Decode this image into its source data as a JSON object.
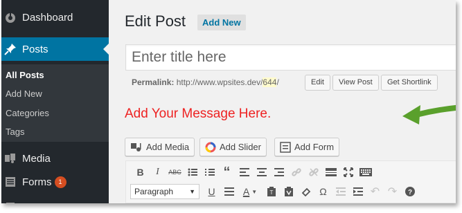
{
  "sidebar": {
    "dashboard": "Dashboard",
    "posts": "Posts",
    "submenu": [
      "All Posts",
      "Add New",
      "Categories",
      "Tags"
    ],
    "media": "Media",
    "forms": "Forms",
    "forms_badge": "1"
  },
  "main": {
    "title": "Edit Post",
    "add_new": "Add New",
    "title_placeholder": "Enter title here",
    "permalink_label": "Permalink:",
    "permalink_url": "http://www.wpsites.dev/",
    "permalink_slug": "644",
    "permalink_trail": "/",
    "edit_btn": "Edit",
    "view_post_btn": "View Post",
    "shortlink_btn": "Get Shortlink",
    "message": "Add Your Message Here.",
    "add_media": "Add Media",
    "add_slider": "Add Slider",
    "add_form": "Add Form",
    "paragraph": "Paragraph"
  },
  "colors": {
    "sidebar_bg": "#23282d",
    "active_bg": "#0074a2",
    "message": "#ee2222",
    "arrow": "#5aa02c"
  }
}
